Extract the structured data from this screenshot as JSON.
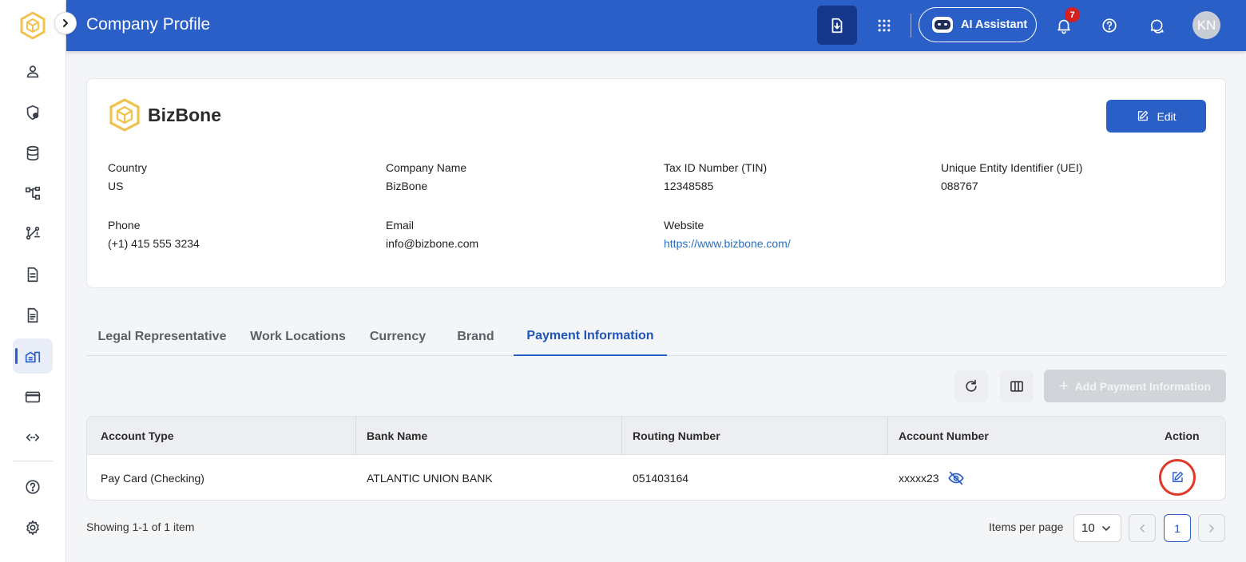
{
  "header": {
    "title": "Company Profile",
    "ai_label": "AI Assistant",
    "notification_count": "7",
    "avatar_initials": "KN"
  },
  "sidebar": {
    "items": [
      {
        "icon": "user-icon"
      },
      {
        "icon": "shield-icon"
      },
      {
        "icon": "database-icon"
      },
      {
        "icon": "hierarchy-icon"
      },
      {
        "icon": "workflow-icon"
      },
      {
        "icon": "document-icon"
      },
      {
        "icon": "file-icon"
      },
      {
        "icon": "company-icon",
        "active": true
      },
      {
        "icon": "credit-card-icon"
      },
      {
        "icon": "integration-icon"
      },
      {
        "icon": "help-icon"
      },
      {
        "icon": "settings-icon"
      }
    ]
  },
  "company": {
    "name": "BizBone",
    "edit_label": "Edit",
    "fields": {
      "country": {
        "label": "Country",
        "value": "US"
      },
      "company_name": {
        "label": "Company Name",
        "value": "BizBone"
      },
      "tin": {
        "label": "Tax ID Number (TIN)",
        "value": "12348585"
      },
      "uei": {
        "label": "Unique Entity Identifier (UEI)",
        "value": "088767"
      },
      "phone": {
        "label": "Phone",
        "value": "(+1) 415 555 3234"
      },
      "email": {
        "label": "Email",
        "value": "info@bizbone.com"
      },
      "website": {
        "label": "Website",
        "value": "https://www.bizbone.com/"
      }
    }
  },
  "tabs": [
    {
      "label": "Legal Representative"
    },
    {
      "label": "Work Locations"
    },
    {
      "label": "Currency"
    },
    {
      "label": "Brand"
    },
    {
      "label": "Payment Information",
      "active": true
    }
  ],
  "toolbar": {
    "add_label": "Add Payment Information"
  },
  "table": {
    "columns": [
      "Account Type",
      "Bank Name",
      "Routing Number",
      "Account Number",
      "Action"
    ],
    "rows": [
      {
        "account_type": "Pay Card (Checking)",
        "bank_name": "ATLANTIC UNION BANK",
        "routing_number": "051403164",
        "account_number": "xxxxx23"
      }
    ]
  },
  "footer": {
    "showing": "Showing 1-1 of 1 item",
    "items_per_page_label": "Items per page",
    "items_per_page_value": "10",
    "current_page": "1"
  },
  "colors": {
    "primary": "#2a5fc8",
    "header_bg": "#2a5fc8",
    "export_bg": "#17378a",
    "badge": "#d62020",
    "highlight_ring": "#e03b2a",
    "logo": "#f2c14e"
  }
}
